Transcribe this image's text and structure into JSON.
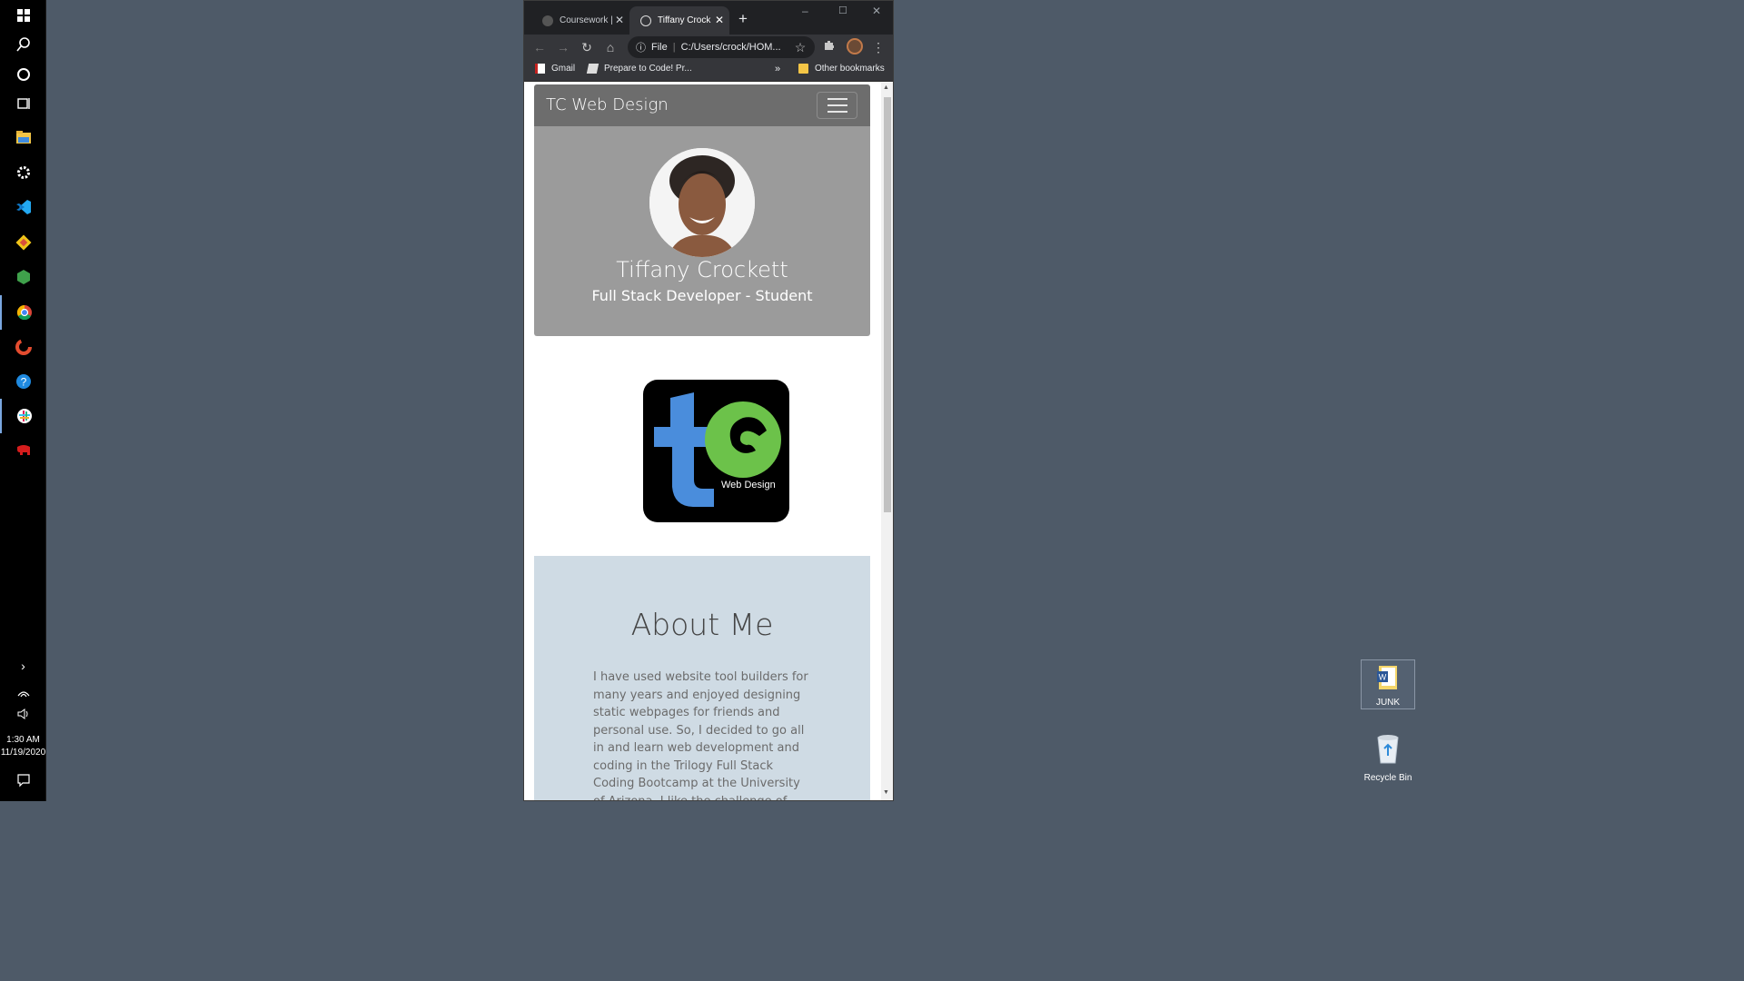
{
  "taskbar": {
    "items": [
      "start",
      "search",
      "cortana",
      "task-view",
      "file-explorer",
      "settings",
      "vscode",
      "git",
      "node",
      "chrome",
      "ccleaner",
      "help",
      "slack",
      "app"
    ],
    "clock": {
      "time": "1:30 AM",
      "date": "11/19/2020"
    }
  },
  "desktop": {
    "icons": [
      {
        "label": "JUNK",
        "icon": "word-document-icon"
      },
      {
        "label": "Recycle Bin",
        "icon": "recycle-bin-icon"
      }
    ]
  },
  "browser": {
    "tabs": [
      {
        "title": "Coursework |",
        "active": false
      },
      {
        "title": "Tiffany Crock",
        "active": true
      }
    ],
    "address": {
      "scheme": "File",
      "url": "C:/Users/crock/HOM..."
    },
    "bookmarks": [
      {
        "label": "Gmail"
      },
      {
        "label": "Prepare to Code! Pr..."
      }
    ],
    "overflow": "»",
    "other_bookmarks": "Other bookmarks"
  },
  "page": {
    "navbar": {
      "brand": "TC Web Design"
    },
    "hero": {
      "name": "Tiffany Crockett",
      "subtitle": "Full Stack Developer - Student"
    },
    "logo": {
      "text": "Web Design"
    },
    "about": {
      "heading": "About Me",
      "body": "I have used website tool builders for many years and enjoyed designing static webpages for friends and personal use. So, I decided to go all in and learn web development and coding in the Trilogy Full Stack Coding Bootcamp at the University of Arizona. I like the challenge of"
    }
  },
  "colors": {
    "navbar": "#6d6d6d",
    "hero": "#9b9b9b",
    "about": "#cfdbe4",
    "desktop": "#4e5a68"
  }
}
